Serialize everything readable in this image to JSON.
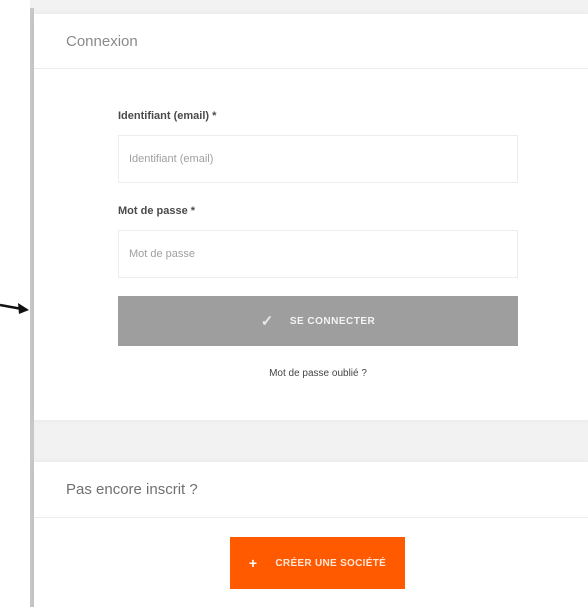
{
  "login": {
    "title": "Connexion",
    "email_label": "Identifiant (email) *",
    "email_placeholder": "Identifiant (email)",
    "email_value": "",
    "password_label": "Mot de passe *",
    "password_placeholder": "Mot de passe",
    "password_value": "",
    "connect_icon": "check-icon",
    "connect_label": "SE CONNECTER",
    "forgot_label": "Mot de passe oublié ?"
  },
  "signup": {
    "title": "Pas encore inscrit ?",
    "create_icon": "plus-icon",
    "create_label": "CRÉER UNE SOCIÉTÉ"
  },
  "colors": {
    "connect_button": "#9e9e9e",
    "create_button": "#ff5a00",
    "page_background": "#f2f2f2"
  }
}
